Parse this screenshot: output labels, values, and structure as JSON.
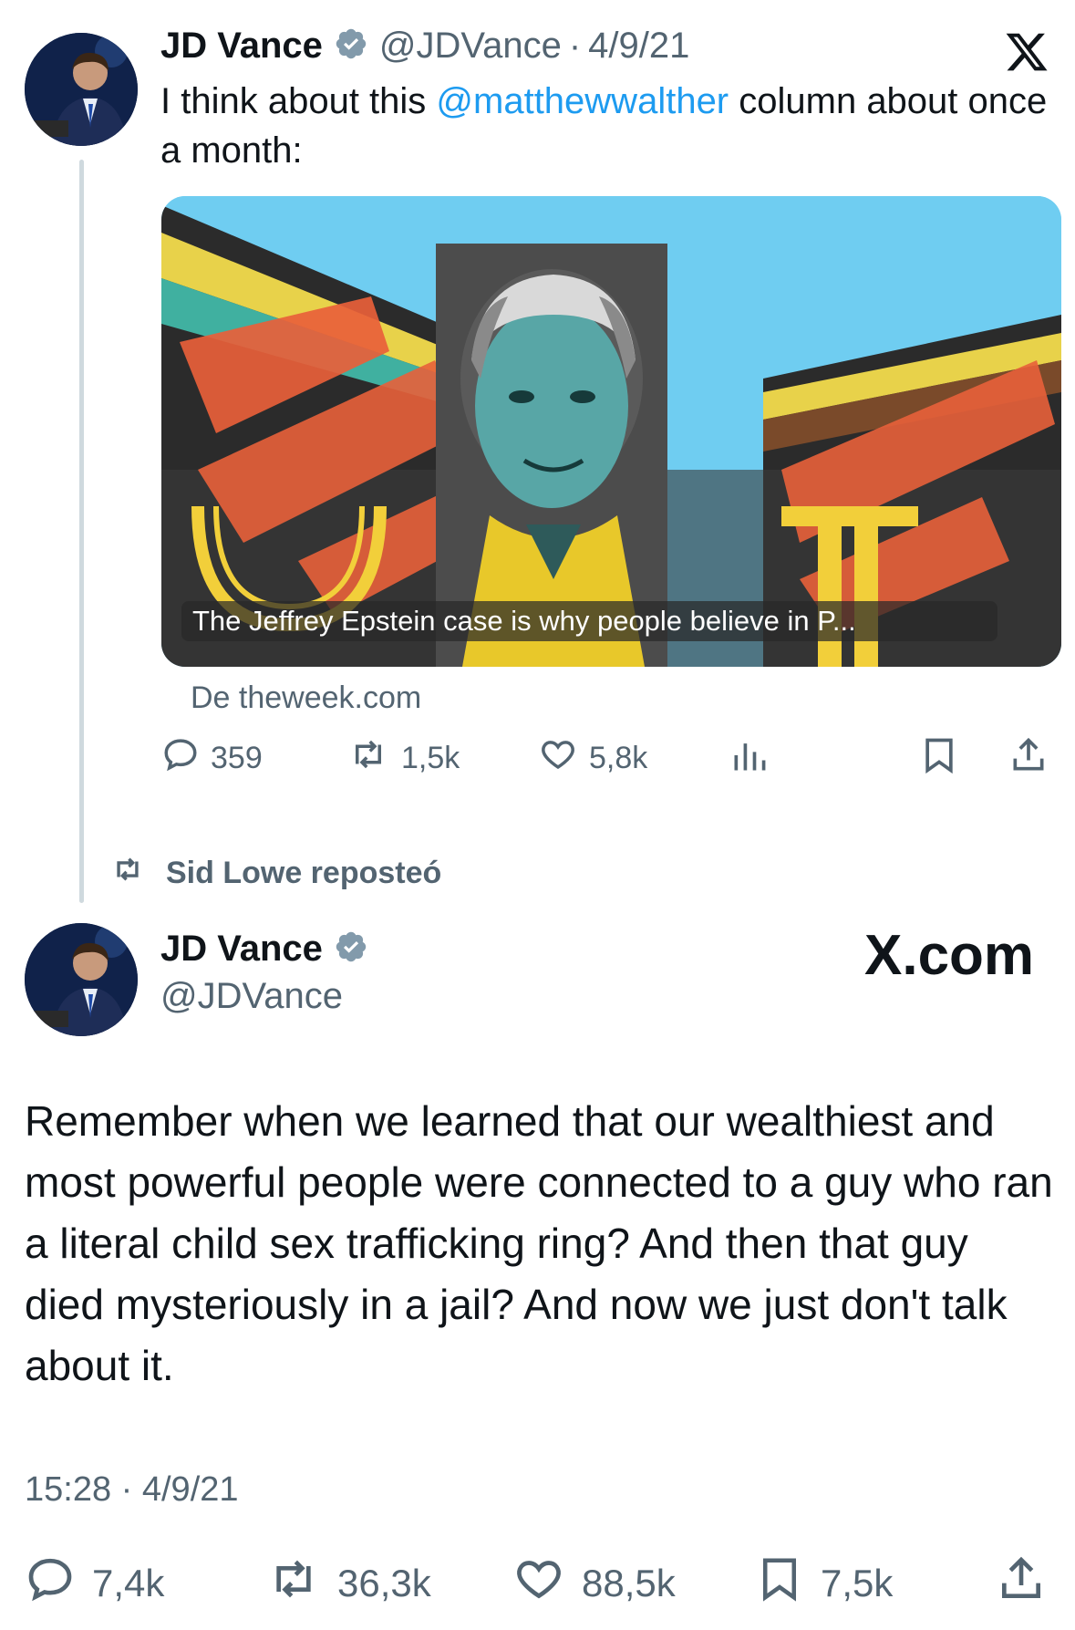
{
  "quoted_tweet": {
    "author_name": "JD Vance",
    "author_handle": "@JDVance",
    "separator": "·",
    "date": "4/9/21",
    "text_before": "I think about this ",
    "mention": "@matthewwalther",
    "text_after": " column about once a month:",
    "card": {
      "caption": "The Jeffrey Epstein case is why people believe in P...",
      "source": "De theweek.com"
    },
    "stats": {
      "replies": "359",
      "reposts": "1,5k",
      "likes": "5,8k"
    },
    "platform_logo": "X"
  },
  "repost_banner": {
    "text": "Sid Lowe reposteó"
  },
  "main_tweet": {
    "author_name": "JD Vance",
    "author_handle": "@JDVance",
    "brand": "X.com",
    "text": "Remember when we learned that our wealthiest and most powerful people were connected to a guy who ran a literal child sex trafficking ring? And then that guy died mysteriously in a jail? And now we just don't talk about it.",
    "timestamp": "15:28 · 4/9/21",
    "stats": {
      "replies": "7,4k",
      "reposts": "36,3k",
      "likes": "88,5k",
      "bookmarks": "7,5k"
    }
  },
  "colors": {
    "text": "#0f1419",
    "muted": "#536471",
    "link": "#1d9bf0",
    "verified": "#829aab",
    "thread_line": "#cfd9de"
  },
  "icons": [
    "verified-badge-icon",
    "x-logo-icon",
    "reply-icon",
    "repost-icon",
    "like-icon",
    "views-icon",
    "bookmark-icon",
    "share-icon"
  ]
}
